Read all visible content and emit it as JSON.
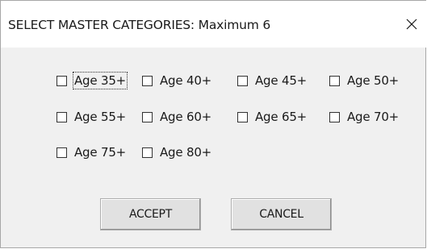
{
  "dialog": {
    "title": "SELECT MASTER CATEGORIES: Maximum 6",
    "close_icon": "close-x-icon"
  },
  "categories": [
    {
      "label": "Age 35+",
      "checked": false,
      "focused": true
    },
    {
      "label": "Age 40+",
      "checked": false
    },
    {
      "label": "Age 45+",
      "checked": false
    },
    {
      "label": "Age 50+",
      "checked": false
    },
    {
      "label": "Age 55+",
      "checked": false
    },
    {
      "label": "Age 60+",
      "checked": false
    },
    {
      "label": "Age 65+",
      "checked": false
    },
    {
      "label": "Age 70+",
      "checked": false
    },
    {
      "label": "Age 75+",
      "checked": false
    },
    {
      "label": "Age 80+",
      "checked": false
    }
  ],
  "buttons": {
    "accept_label": "ACCEPT",
    "cancel_label": "CANCEL"
  }
}
